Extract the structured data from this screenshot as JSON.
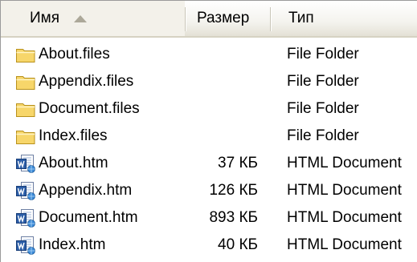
{
  "columns": {
    "name": "Имя",
    "size": "Размер",
    "type": "Тип"
  },
  "sort": {
    "column": "name",
    "direction": "ascending",
    "indicator": "sort-up-arrow"
  },
  "colors": {
    "header_bg": "#f4f3ee",
    "header_border": "#d6d2c2",
    "folder_fill": "#f7d66a",
    "folder_outline": "#b8911c",
    "doc_blue": "#2c5ea8"
  },
  "files": [
    {
      "name": "About.files",
      "size": "",
      "type": "File Folder",
      "icon": "folder-icon"
    },
    {
      "name": "Appendix.files",
      "size": "",
      "type": "File Folder",
      "icon": "folder-icon"
    },
    {
      "name": "Document.files",
      "size": "",
      "type": "File Folder",
      "icon": "folder-icon"
    },
    {
      "name": "Index.files",
      "size": "",
      "type": "File Folder",
      "icon": "folder-icon"
    },
    {
      "name": "About.htm",
      "size": "37 КБ",
      "type": "HTML Document",
      "icon": "word-document-icon"
    },
    {
      "name": "Appendix.htm",
      "size": "126 КБ",
      "type": "HTML Document",
      "icon": "word-document-icon"
    },
    {
      "name": "Document.htm",
      "size": "893 КБ",
      "type": "HTML Document",
      "icon": "word-document-icon"
    },
    {
      "name": "Index.htm",
      "size": "40 КБ",
      "type": "HTML Document",
      "icon": "word-document-icon"
    }
  ]
}
